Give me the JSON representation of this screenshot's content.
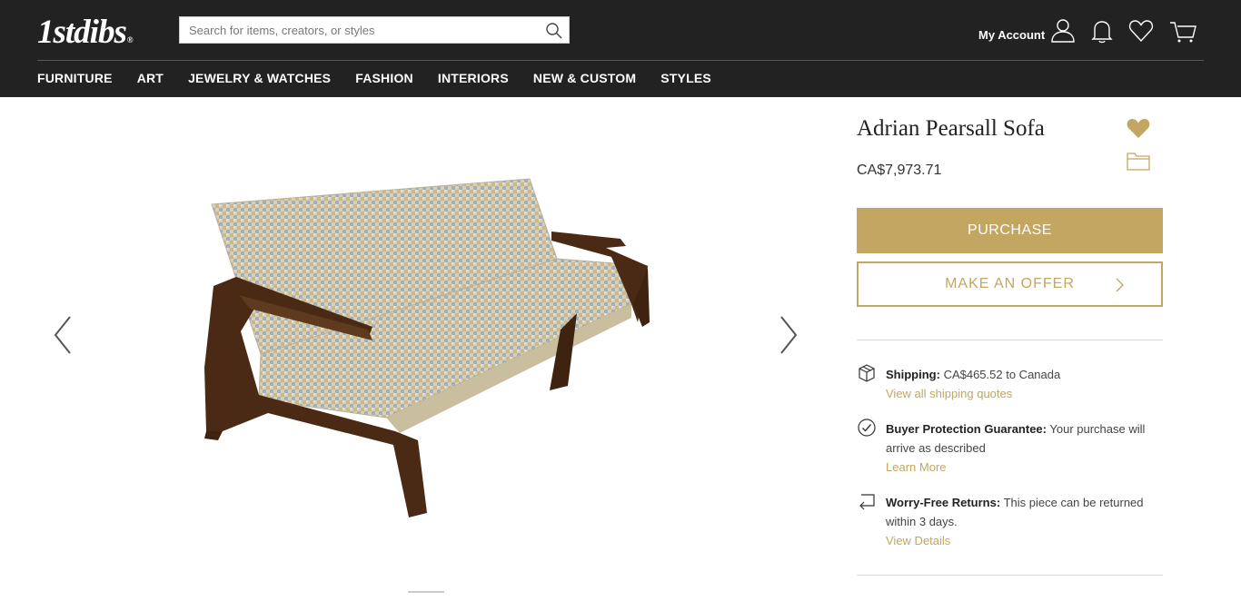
{
  "header": {
    "logo": "1stdibs",
    "logo_mark": "®",
    "search_placeholder": "Search for items, creators, or styles",
    "account_label": "My Account"
  },
  "nav": {
    "items": [
      "FURNITURE",
      "ART",
      "JEWELRY & WATCHES",
      "FASHION",
      "INTERIORS",
      "NEW & CUSTOM",
      "STYLES"
    ]
  },
  "product": {
    "title": "Adrian Pearsall Sofa",
    "price": "CA$7,973.71",
    "purchase_label": "PURCHASE",
    "offer_label": "MAKE AN OFFER"
  },
  "shipping": {
    "label": "Shipping:",
    "text": "CA$465.52 to Canada",
    "link": "View all shipping quotes"
  },
  "protection": {
    "label": "Buyer Protection Guarantee:",
    "text": "Your purchase will arrive as described",
    "link": "Learn More"
  },
  "returns": {
    "label": "Worry-Free Returns:",
    "text": "This piece can be returned within 3 days.",
    "link": "View Details"
  },
  "colors": {
    "header_bg": "#222222",
    "accent_gold": "#c2a661"
  },
  "icons": [
    "search-icon",
    "user-icon",
    "bell-icon",
    "heart-icon",
    "cart-icon",
    "chevron-left-icon",
    "chevron-right-icon",
    "heart-filled-icon",
    "folder-icon",
    "box-icon",
    "check-circle-icon",
    "return-arrow-icon"
  ]
}
